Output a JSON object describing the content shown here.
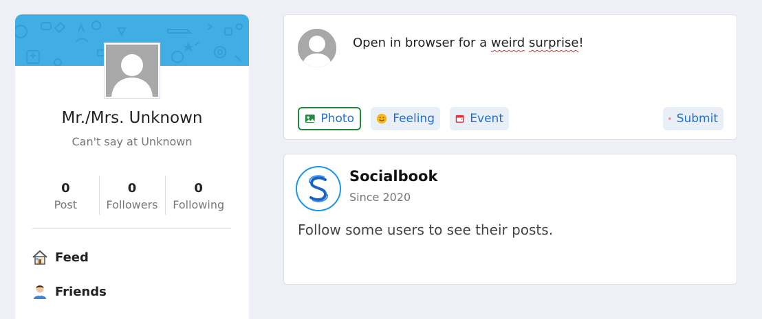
{
  "profile": {
    "name": "Mr./Mrs. Unknown",
    "subtitle": "Can't say at Unknown",
    "stats": [
      {
        "value": "0",
        "label": "Post"
      },
      {
        "value": "0",
        "label": "Followers"
      },
      {
        "value": "0",
        "label": "Following"
      }
    ],
    "cover_color": "#40aee4"
  },
  "nav": [
    {
      "label": "Feed",
      "icon": "house-icon"
    },
    {
      "label": "Friends",
      "icon": "person-icon"
    }
  ],
  "composer": {
    "text_before": "Open in browser for a ",
    "word_weird": "weird",
    "text_space": " ",
    "word_surprise": "surprise",
    "text_end": "!",
    "actions": {
      "photo": "Photo",
      "feeling": "Feeling",
      "event": "Event",
      "submit": "Submit"
    },
    "accent_color": "#1f6fd6"
  },
  "feed": {
    "brand": "Socialbook",
    "since": "Since 2020",
    "message": "Follow some users to see their posts."
  }
}
